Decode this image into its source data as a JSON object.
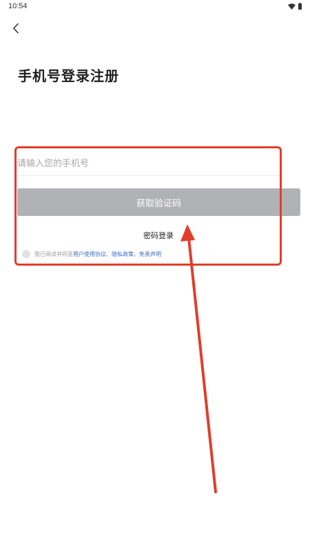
{
  "status_bar": {
    "time": "10:54",
    "icons": [
      "wifi-icon",
      "battery-icon"
    ]
  },
  "header": {
    "back_icon": "chevron-left-icon"
  },
  "title": "手机号登录注册",
  "phone_input": {
    "placeholder": "请输入您的手机号",
    "value": ""
  },
  "get_code_button": {
    "label": "获取验证码",
    "disabled": true
  },
  "password_login_label": "密码登录",
  "agreement": {
    "checked": false,
    "prefix": "我已阅读并同意",
    "user_agreement": "用户使用协议",
    "sep1": "、",
    "privacy_policy": "隐私政策",
    "sep2": "、",
    "disclaimer": "免责声明"
  },
  "annotation": {
    "color": "#e23d2a",
    "shapes": [
      "highlight-rectangle",
      "arrow"
    ]
  },
  "colors": {
    "button_disabled": "#b1b2b6",
    "link": "#3b6ac9",
    "placeholder": "#a6a6a6"
  }
}
